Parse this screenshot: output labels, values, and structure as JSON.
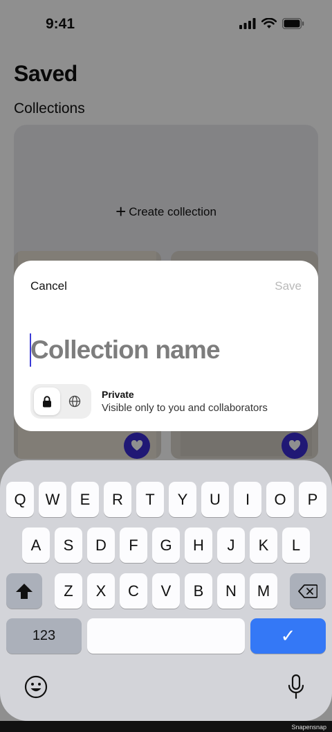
{
  "status_bar": {
    "time": "9:41"
  },
  "page": {
    "title": "Saved",
    "section": "Collections",
    "create_collection_label": "Create collection"
  },
  "sheet": {
    "cancel_label": "Cancel",
    "save_label": "Save",
    "name_placeholder": "Collection name",
    "name_value": "",
    "privacy": {
      "selected": "private",
      "title": "Private",
      "description": "Visible only to you and collaborators"
    }
  },
  "keyboard": {
    "row1": [
      "Q",
      "W",
      "E",
      "R",
      "T",
      "Y",
      "U",
      "I",
      "O",
      "P"
    ],
    "row2": [
      "A",
      "S",
      "D",
      "F",
      "G",
      "H",
      "J",
      "K",
      "L"
    ],
    "row3": [
      "Z",
      "X",
      "C",
      "V",
      "B",
      "N",
      "M"
    ],
    "numbers_label": "123",
    "done_glyph": "✓"
  },
  "colors": {
    "accent": "#3a2bd1",
    "done_key": "#3478f6",
    "caret": "#3b3bd6"
  },
  "watermark": "Snapensnap"
}
